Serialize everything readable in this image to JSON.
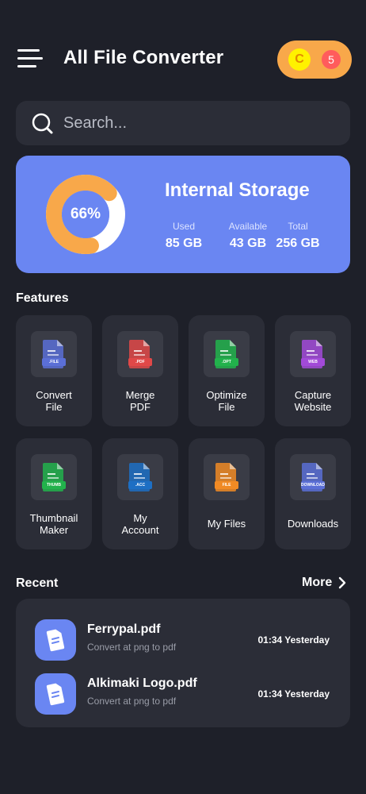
{
  "header": {
    "title": "All File Converter",
    "coin_symbol": "C",
    "coin_count": "5"
  },
  "search": {
    "placeholder": "Search..."
  },
  "storage": {
    "percent": "66%",
    "percent_value": 66,
    "title": "Internal Storage",
    "used_label": "Used",
    "used_value": "85 GB",
    "available_label": "Available",
    "available_value": "43 GB",
    "total_label": "Total",
    "total_value": "256 GB"
  },
  "features": {
    "title": "Features",
    "items": [
      {
        "label": "Convert File",
        "line1": "Convert",
        "line2": "File",
        "tag": ".FILE",
        "icon": "file-icon",
        "color": "#5b6fd6"
      },
      {
        "label": "Merge PDF",
        "line1": "Merge",
        "line2": "PDF",
        "tag": ".PDF",
        "icon": "pdf-icon",
        "color": "#e04848"
      },
      {
        "label": "Optimize File",
        "line1": "Optimize",
        "line2": "File",
        "tag": ".OPT",
        "icon": "optimize-icon",
        "color": "#22b24c"
      },
      {
        "label": "Capture Website",
        "line1": "Capture",
        "line2": "Website",
        "tag": "WEB",
        "icon": "code-icon",
        "color": "#a24ad8"
      },
      {
        "label": "Thumbnail Maker",
        "line1": "Thumbnail",
        "line2": "Maker",
        "tag": "THUMB",
        "icon": "thumbnail-icon",
        "color": "#22b24c"
      },
      {
        "label": "My Account",
        "line1": "My",
        "line2": "Account",
        "tag": ".ACC",
        "icon": "account-icon",
        "color": "#1d6fc4"
      },
      {
        "label": "My Files",
        "line1": "My Files",
        "line2": "",
        "tag": "FILE",
        "icon": "folder-icon",
        "color": "#f08a24"
      },
      {
        "label": "Downloads",
        "line1": "Downloads",
        "line2": "",
        "tag": "DOWNLOAD",
        "icon": "download-icon",
        "color": "#5b6fd6"
      }
    ]
  },
  "recent": {
    "title": "Recent",
    "more_label": "More",
    "items": [
      {
        "name": "Ferrypal.pdf",
        "subtitle": "Convert at png to pdf",
        "time": "01:34 Yesterday"
      },
      {
        "name": "Alkimaki Logo.pdf",
        "subtitle": "Convert at png to pdf",
        "time": "01:34 Yesterday"
      }
    ]
  },
  "colors": {
    "background": "#1e2029",
    "card": "#2b2d37",
    "accent": "#6a86f2",
    "donut_fill": "#f8a84a",
    "coin_pill": "#f8a84a"
  }
}
